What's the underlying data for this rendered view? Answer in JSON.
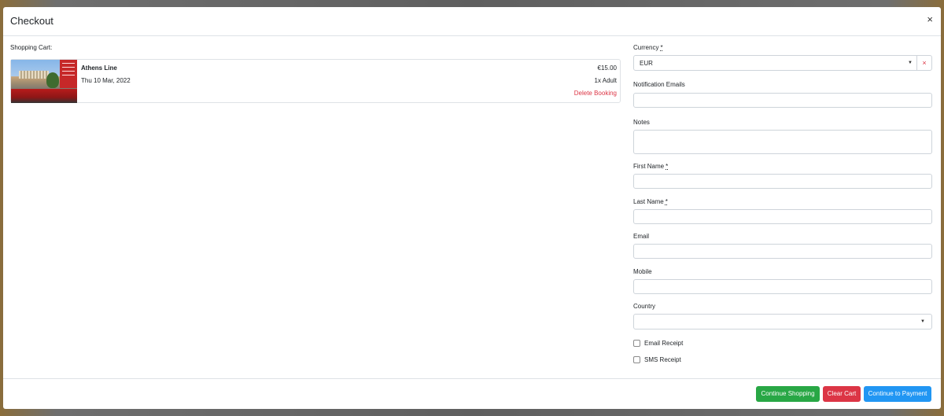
{
  "modal": {
    "title": "Checkout",
    "close_label": "×"
  },
  "cart": {
    "title": "Shopping Cart:",
    "items": [
      {
        "name": "Athens Line",
        "date": "Thu 10 Mar, 2022",
        "price": "€15.00",
        "quantity": "1x Adult",
        "delete_label": "Delete Booking",
        "image_icon": "tour-photo"
      }
    ]
  },
  "form": {
    "currency": {
      "label": "Currency",
      "required_mark": "*",
      "value": "EUR",
      "clear_label": "×"
    },
    "notification_emails": {
      "label": "Notification Emails",
      "value": ""
    },
    "notes": {
      "label": "Notes",
      "value": ""
    },
    "first_name": {
      "label": "First Name",
      "required_mark": "*",
      "value": ""
    },
    "last_name": {
      "label": "Last Name",
      "required_mark": "*",
      "value": ""
    },
    "email": {
      "label": "Email",
      "value": ""
    },
    "mobile": {
      "label": "Mobile",
      "value": ""
    },
    "country": {
      "label": "Country",
      "value": ""
    },
    "email_receipt": {
      "label": "Email Receipt",
      "checked": false
    },
    "sms_receipt": {
      "label": "SMS Receipt",
      "checked": false
    }
  },
  "footer": {
    "continue_shopping": "Continue Shopping",
    "clear_cart": "Clear Cart",
    "continue_payment": "Continue to Payment"
  },
  "colors": {
    "success": "#28a745",
    "danger": "#dc3545",
    "primary": "#2196f3"
  }
}
